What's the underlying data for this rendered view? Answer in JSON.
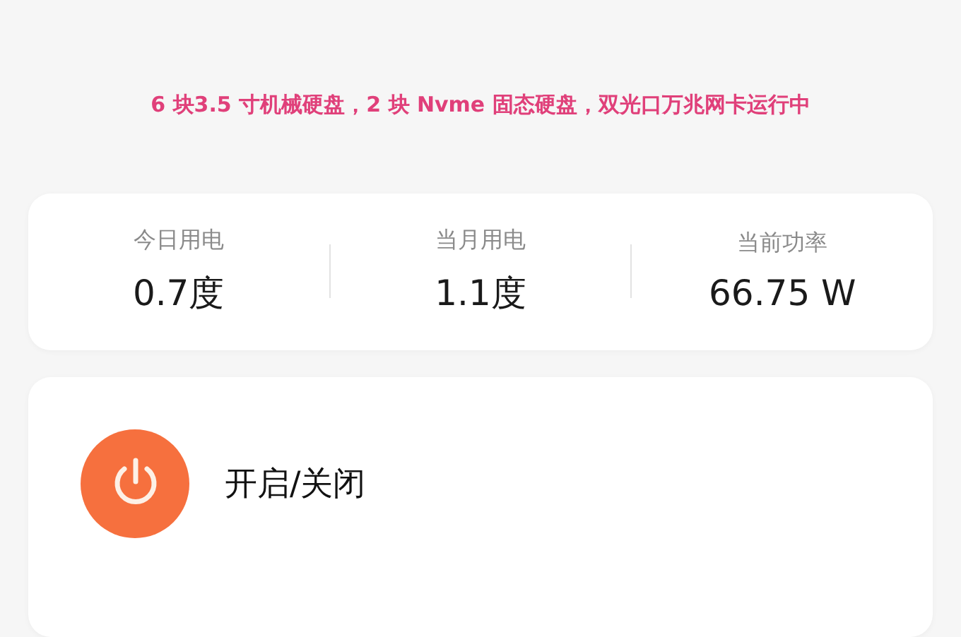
{
  "caption": "6 块3.5 寸机械硬盘，2 块 Nvme 固态硬盘，双光口万兆网卡运行中",
  "stats": [
    {
      "label": "今日用电",
      "value": "0.7度"
    },
    {
      "label": "当月用电",
      "value": "1.1度"
    },
    {
      "label": "当前功率",
      "value": "66.75 W"
    }
  ],
  "power": {
    "label": "开启/关闭",
    "on": true
  }
}
